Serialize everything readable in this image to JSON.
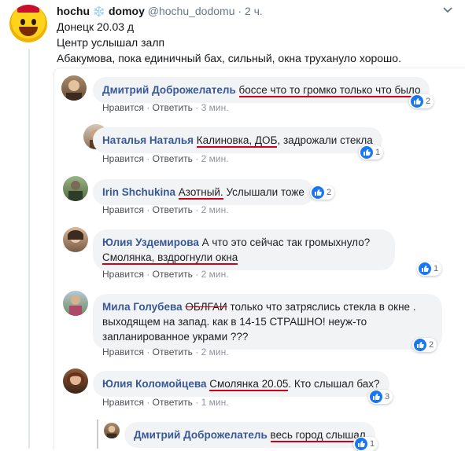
{
  "tweet": {
    "name": "hochu",
    "name_suffix": "domoy",
    "handle": "@hochu_dodomu",
    "time": "· 2 ч.",
    "line1": "Донецк 20.03   д",
    "line2": "Центр услышал залп",
    "line3": "Абакумова, пока единичный бах, сильный, окна трухануло хорошо."
  },
  "actions": {
    "like": "Нравится",
    "reply": "Ответить",
    "sep": "·"
  },
  "comments": [
    {
      "name": "Дмитрий Доброжелатель",
      "text": "боссе что то громко только что было",
      "time": "3 мин.",
      "likes": "2"
    },
    {
      "name": "Наталья Наталья",
      "text_a": "Калиновка, ДОБ",
      "text_b": ", задрожали стекла",
      "time": "2 мин.",
      "likes": "1"
    },
    {
      "name": "Irin Shchukina",
      "text_a": "Азотный.",
      "text_b": " Услышали тоже",
      "time": "2 мин.",
      "likes": "2"
    },
    {
      "name": "Юлия Уздемирова",
      "text_a": " А что это сейчас так громыхнуло?",
      "text_b": "Смолянка, вздрогнули окна",
      "time": "2 мин.",
      "likes": "1"
    },
    {
      "name": "Мила Голубева",
      "text_a": "ОБЛГАИ",
      "text_b": " только что затряслись стекла в окне .",
      "text_c": "выходящем на запад. как в 14-15 СТРАШНО! неуж-то",
      "text_d": "запланированное украми ???",
      "time": "2 мин.",
      "likes": "2"
    },
    {
      "name": "Юлия Коломойцева",
      "text_a": "Смолянка 20.05",
      "text_b": ". Кто слышал бах?",
      "time": "1 мин.",
      "likes": "3"
    }
  ],
  "reply": {
    "name": "Дмитрий Доброжелатель",
    "text": "весь город слышал",
    "likes": "1"
  }
}
